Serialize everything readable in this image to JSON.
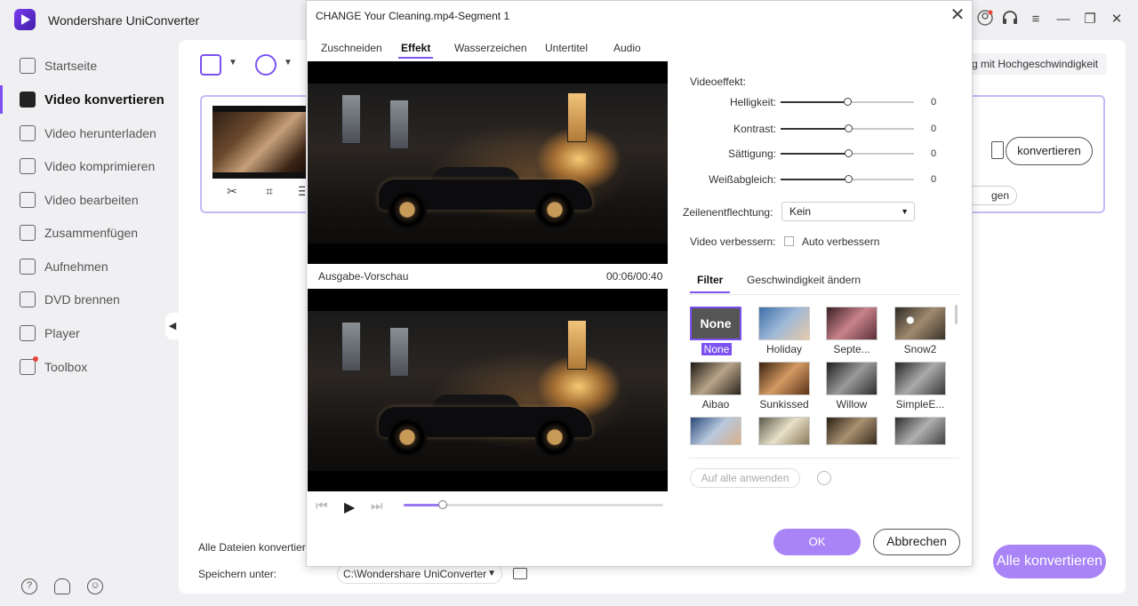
{
  "app": {
    "title": "Wondershare UniConverter",
    "icons": [
      "avatar-icon",
      "headset-icon",
      "menu-icon",
      "minimize-icon",
      "maximize-icon",
      "close-icon"
    ]
  },
  "sidebar": {
    "items": [
      {
        "label": "Startseite",
        "icon": "home-icon"
      },
      {
        "label": "Video konvertieren",
        "icon": "video-convert-icon",
        "active": true
      },
      {
        "label": "Video herunterladen",
        "icon": "download-icon"
      },
      {
        "label": "Video komprimieren",
        "icon": "compress-icon"
      },
      {
        "label": "Video bearbeiten",
        "icon": "scissors-icon"
      },
      {
        "label": "Zusammenfügen",
        "icon": "merge-icon"
      },
      {
        "label": "Aufnehmen",
        "icon": "record-icon"
      },
      {
        "label": "DVD brennen",
        "icon": "dvd-icon"
      },
      {
        "label": "Player",
        "icon": "player-icon"
      },
      {
        "label": "Toolbox",
        "icon": "toolbox-icon",
        "badge": true
      }
    ],
    "footer_icons": [
      "help-icon",
      "bell-icon",
      "feedback-icon"
    ]
  },
  "main": {
    "speed_label": "g mit Hochgeschwindigkeit",
    "convert_label": "konvertieren",
    "partial_pill_label": "gen",
    "all_files_label": "Alle Dateien konvertiere",
    "save_label": "Speichern unter:",
    "save_path": "C:\\Wondershare UniConverter",
    "convert_all_label": "Alle konvertieren"
  },
  "dialog": {
    "title": "CHANGE Your Cleaning.mp4-Segment 1",
    "tabs": [
      {
        "label": "Zuschneiden"
      },
      {
        "label": "Effekt",
        "active": true
      },
      {
        "label": "Wasserzeichen"
      },
      {
        "label": "Untertitel"
      },
      {
        "label": "Audio"
      }
    ],
    "output_preview_label": "Ausgabe-Vorschau",
    "timecode": "00:06/00:40",
    "playback_progress": 0.15,
    "video_effect_label": "Videoeffekt:",
    "sliders": [
      {
        "label": "Helligkeit:",
        "value": "0",
        "position": 0.5
      },
      {
        "label": "Kontrast:",
        "value": "0",
        "position": 0.51
      },
      {
        "label": "Sättigung:",
        "value": "0",
        "position": 0.51
      },
      {
        "label": "Weißabgleich:",
        "value": "0",
        "position": 0.51
      }
    ],
    "deinterlace_label": "Zeilenentflechtung:",
    "deinterlace_value": "Kein",
    "enhance_label": "Video verbessern:",
    "auto_enhance_label": "Auto verbessern",
    "subtabs": [
      {
        "label": "Filter",
        "active": true
      },
      {
        "label": "Geschwindigkeit ändern"
      }
    ],
    "filters": [
      {
        "name": "None",
        "thumb_text": "None",
        "selected": true
      },
      {
        "name": "Holiday"
      },
      {
        "name": "Septe..."
      },
      {
        "name": "Snow2"
      },
      {
        "name": "Aibao"
      },
      {
        "name": "Sunkissed"
      },
      {
        "name": "Willow"
      },
      {
        "name": "SimpleE..."
      },
      {
        "name": ""
      },
      {
        "name": ""
      },
      {
        "name": ""
      },
      {
        "name": ""
      }
    ],
    "apply_all_label": "Auf alle anwenden",
    "ok_label": "OK",
    "cancel_label": "Abbrechen"
  }
}
